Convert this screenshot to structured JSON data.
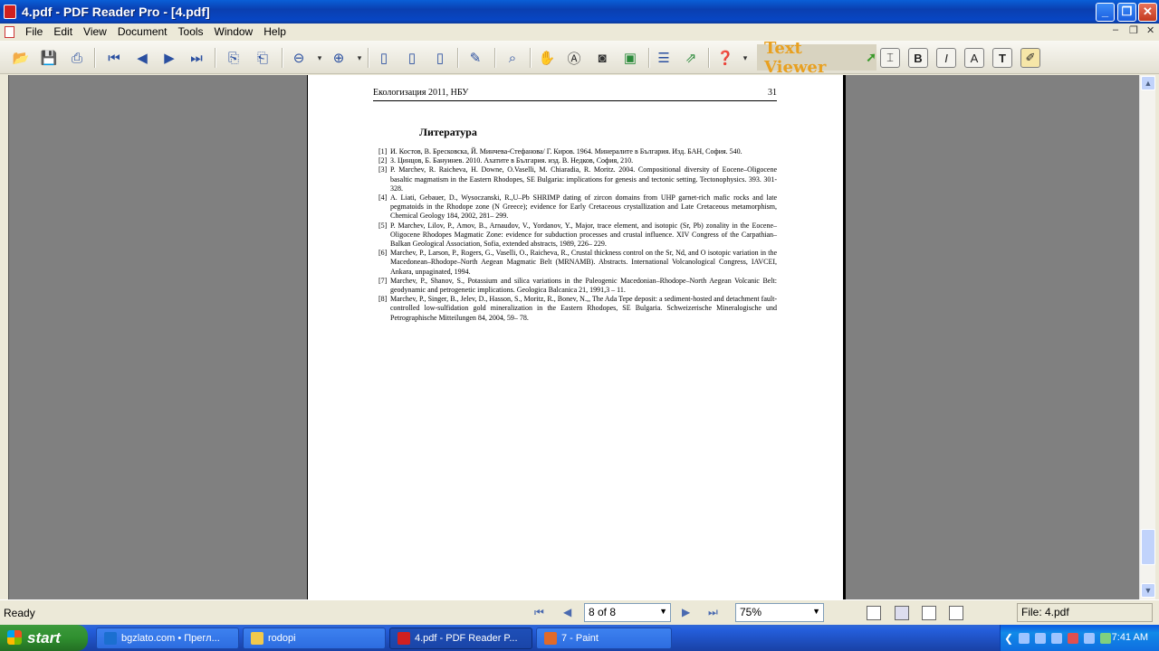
{
  "window": {
    "title": "4.pdf - PDF Reader Pro - [4.pdf]",
    "minimize": "_",
    "restore": "❐",
    "close": "✕"
  },
  "menu": {
    "items": [
      "File",
      "Edit",
      "View",
      "Document",
      "Tools",
      "Window",
      "Help"
    ],
    "mdi_minimize": "–",
    "mdi_restore": "❐",
    "mdi_close": "✕"
  },
  "toolbar": {
    "text_viewer_label": "Text Viewer"
  },
  "document": {
    "header_left": "Екологизация 2011, НБУ",
    "header_right": "31",
    "section_title": "Литература",
    "references": [
      {
        "num": "[1]",
        "text": "И. Костов, В. Бресковска, Й. Минчева-Стефанова/ Г. Киров. 1964. Минералите в България. Изд. БАН, София. 540."
      },
      {
        "num": "[2]",
        "text": "З. Цинцов, Б. Бануинев. 2010. Ахатите в България. изд. В. Недков, София, 210."
      },
      {
        "num": "[3]",
        "text": "P. Marchev, R. Raicheva, H. Downe, O.Vaselli, M. Chiaradia, R. Moritz. 2004. Compositional diversity of Eocene–Oligocene basaltic magmatism in the Eastern Rhodopes, SE Bulgaria: implications for genesis and tectonic setting. Tectonophysics. 393. 301-328."
      },
      {
        "num": "[4]",
        "text": "A. Liati, Gebauer, D., Wysoczanski, R.,U–Pb SHRIMP dating of zircon domains from UHP garnet-rich mafic rocks and late pegmatoids in the Rhodope zone (N Greece); evidence for Early Cretaceous crystallization and Late Cretaceous metamorphism, Chemical Geology 184, 2002, 281– 299."
      },
      {
        "num": "[5]",
        "text": "P. Marchev, Lilov, P., Amov, B., Arnaudov, V., Yordanov, Y., Major, trace element, and isotopic (Sr, Pb) zonality in the Eocene–Oligocene Rhodopes Magmatic Zone: evidence for subduction processes and crustal influence. XIV Congress of the Carpathian–Balkan Geological Association, Sofia, extended abstracts, 1989, 226– 229."
      },
      {
        "num": "[6]",
        "text": "Marchev, P., Larson, P., Rogers, G., Vaselli, O., Raicheva, R., Crustal thickness control on the Sr, Nd, and O isotopic variation in the Macedonean–Rhodope–North Aegean Magmatic Belt (MRNAMB). Abstracts. International Volcanological Congress, IAVCEI, Ankara, unpaginated, 1994."
      },
      {
        "num": "[7]",
        "text": "Marchev, P., Shanov, S., Potassium and silica variations in the Paleogenic Macedonian–Rhodope–North Aegean Volcanic Belt: geodynamic and petrogenetic implications. Geologica Balcanica 21, 1991,3 – 11."
      },
      {
        "num": "[8]",
        "text": "Marchev, P., Singer, B., Jelev, D., Hasson, S., Moritz, R., Bonev, N.,, The Ada Tepe deposit: a sediment-hosted and detachment fault-controlled low-sulfidation gold mineralization in the Eastern Rhodopes, SE Bulgaria. Schweizerische Mineralogische und Petrographische Mitteilungen 84, 2004, 59– 78."
      }
    ]
  },
  "status": {
    "ready": "Ready",
    "page_indicator": "8 of 8",
    "zoom": "75%",
    "file": "File: 4.pdf"
  },
  "taskbar": {
    "start": "start",
    "tasks": [
      {
        "label": "bgzlato.com • Прегл..."
      },
      {
        "label": "rodopi"
      },
      {
        "label": "4.pdf - PDF Reader P..."
      },
      {
        "label": "7 - Paint"
      }
    ],
    "clock": "7:41 AM"
  },
  "colors": {
    "titlebar": "#0a3fb0",
    "workspace": "#808080",
    "taskbar": "#245edb",
    "start": "#2f8f2f",
    "text_viewer": "#e8a020"
  }
}
